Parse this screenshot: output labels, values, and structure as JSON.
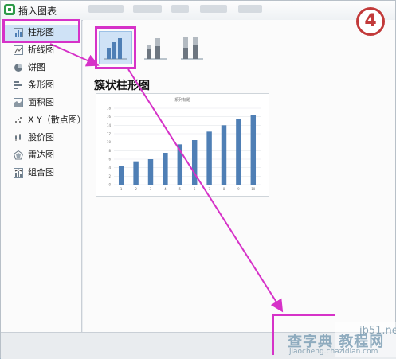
{
  "window": {
    "title": "插入图表"
  },
  "sidebar": {
    "items": [
      {
        "label": "柱形图",
        "icon": "column-chart-icon",
        "selected": true
      },
      {
        "label": "折线图",
        "icon": "line-chart-icon",
        "selected": false
      },
      {
        "label": "饼图",
        "icon": "pie-chart-icon",
        "selected": false
      },
      {
        "label": "条形图",
        "icon": "bar-chart-icon",
        "selected": false
      },
      {
        "label": "面积图",
        "icon": "area-chart-icon",
        "selected": false
      },
      {
        "label": "X Y（散点图）",
        "icon": "scatter-chart-icon",
        "selected": false
      },
      {
        "label": "股价图",
        "icon": "stock-chart-icon",
        "selected": false
      },
      {
        "label": "雷达图",
        "icon": "radar-chart-icon",
        "selected": false
      },
      {
        "label": "组合图",
        "icon": "combo-chart-icon",
        "selected": false
      }
    ]
  },
  "subtypes": [
    {
      "name": "clustered-column",
      "selected": true
    },
    {
      "name": "stacked-column",
      "selected": false
    },
    {
      "name": "percent-stacked-column",
      "selected": false
    }
  ],
  "preview": {
    "heading": "簇状柱形图"
  },
  "chart_data": {
    "type": "bar",
    "title": "系列标题",
    "categories": [
      "1",
      "2",
      "3",
      "4",
      "5",
      "6",
      "7",
      "8",
      "9",
      "10"
    ],
    "series": [
      {
        "values": [
          4.5,
          5.5,
          6,
          7.5,
          9.5,
          10.5,
          12.5,
          14,
          15.5,
          16.5
        ]
      }
    ],
    "ylim": [
      0,
      18
    ],
    "yticks": [
      "0",
      "2",
      "4",
      "6",
      "8",
      "10",
      "12",
      "14",
      "16",
      "18"
    ],
    "grid": true,
    "bar_color": "#4f7fb5"
  },
  "annotations": {
    "step_badge": "4",
    "highlight_color": "#d632c8"
  },
  "watermark": {
    "site": "jb51.net",
    "brand": "查字典 教程网",
    "url": "jiaocheng.chazidian.com"
  }
}
